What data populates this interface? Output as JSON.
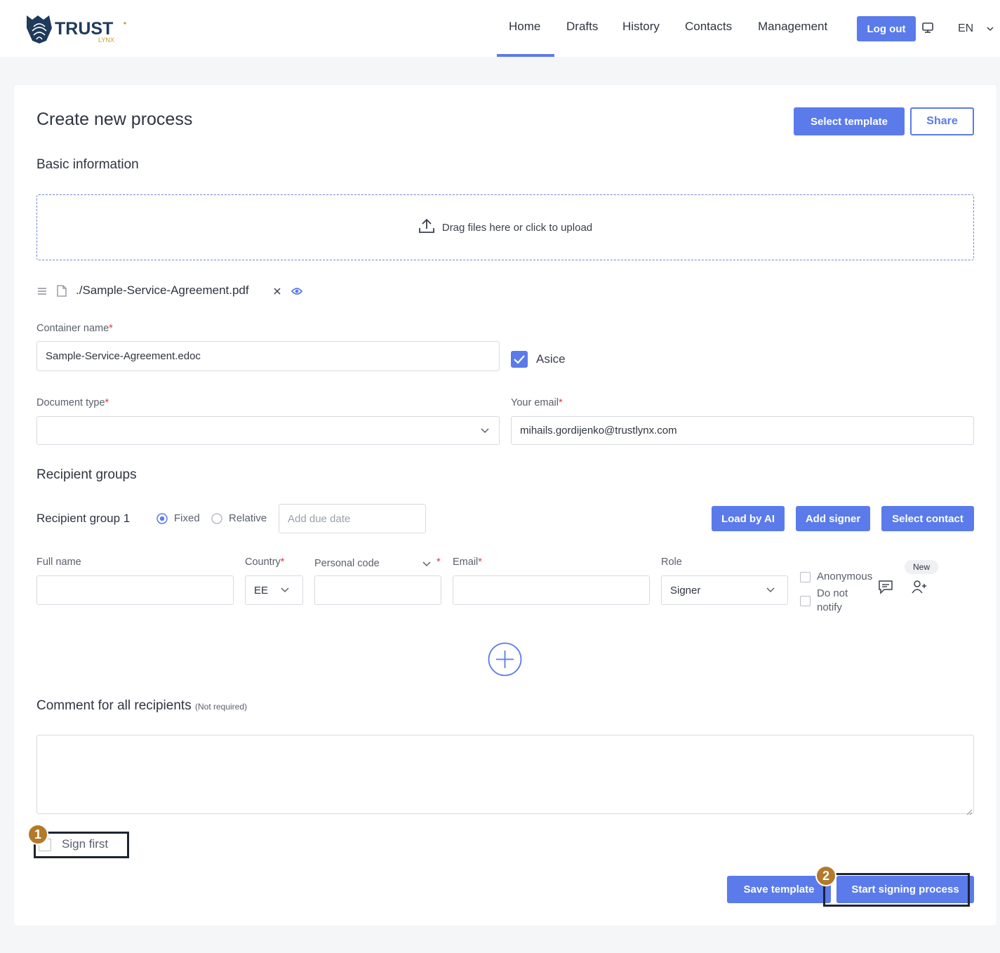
{
  "header": {
    "logo_text": "TRUST",
    "logo_sub": "LYNX",
    "nav": [
      "Home",
      "Drafts",
      "History",
      "Contacts",
      "Management"
    ],
    "logout_label": "Log out",
    "language": "EN"
  },
  "page": {
    "title": "Create new process",
    "select_template_label": "Select template",
    "share_label": "Share"
  },
  "basic": {
    "heading": "Basic information",
    "upload_text": "Drag files here or click to upload",
    "file_name": "./Sample-Service-Agreement.pdf",
    "container_label": "Container name",
    "container_value": "Sample-Service-Agreement.edoc",
    "asice_label": "Asice",
    "asice_checked": true,
    "doc_type_label": "Document type",
    "doc_type_value": "",
    "email_label": "Your email",
    "email_value": "mihails.gordijenko@trustlynx.com",
    "required_mark": "*"
  },
  "recipients": {
    "heading": "Recipient groups",
    "group_label": "Recipient group 1",
    "fixed_label": "Fixed",
    "relative_label": "Relative",
    "due_placeholder": "Add due date",
    "load_ai_label": "Load by AI",
    "add_signer_label": "Add signer",
    "select_contact_label": "Select contact",
    "cols": {
      "full_name": "Full name",
      "country": "Country",
      "personal_code": "Personal code",
      "email": "Email",
      "role": "Role"
    },
    "row": {
      "full_name": "",
      "country": "EE",
      "personal_code": "",
      "email": "",
      "role": "Signer"
    },
    "anonymous_label": "Anonymous",
    "do_not_notify_line1": "Do not",
    "do_not_notify_line2": "notify",
    "new_badge": "New"
  },
  "comment": {
    "heading": "Comment for all recipients",
    "note": "(Not required)",
    "value": ""
  },
  "footer": {
    "sign_first_label": "Sign first",
    "save_template_label": "Save template",
    "start_label": "Start signing process",
    "marker1": "1",
    "marker2": "2"
  },
  "colors": {
    "accent": "#5b7bea",
    "marker": "#b27a2b",
    "required": "#e0393e"
  }
}
